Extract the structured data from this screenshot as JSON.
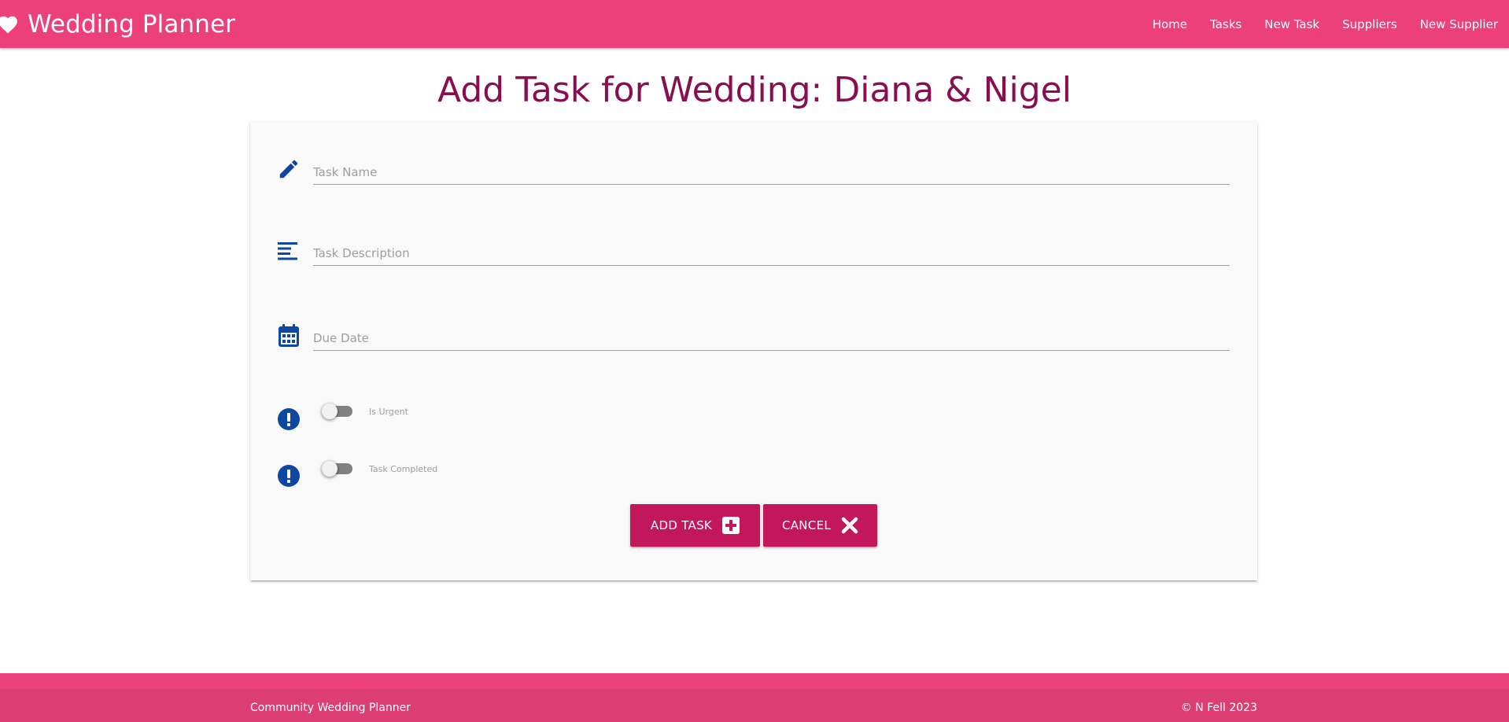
{
  "navbar": {
    "brand_icon": "heart-icon",
    "brand": "Wedding Planner",
    "links": [
      "Home",
      "Tasks",
      "New Task",
      "Suppliers",
      "New Supplier"
    ]
  },
  "page": {
    "title": "Add Task for Wedding: Diana & Nigel"
  },
  "form": {
    "task_name": {
      "icon": "pencil-icon",
      "placeholder": "Task Name",
      "value": ""
    },
    "task_description": {
      "icon": "text-lines-icon",
      "placeholder": "Task Description",
      "value": ""
    },
    "due_date": {
      "icon": "calendar-icon",
      "placeholder": "Due Date",
      "value": ""
    },
    "is_urgent": {
      "icon": "exclamation-circle-icon",
      "label": "Is Urgent",
      "checked": false
    },
    "task_completed": {
      "icon": "exclamation-circle-icon",
      "label": "Task Completed",
      "checked": false
    },
    "add_button": {
      "label": "ADD TASK",
      "icon": "plus-square-icon"
    },
    "cancel_button": {
      "label": "CANCEL",
      "icon": "close-icon"
    }
  },
  "footer": {
    "left": "Community Wedding Planner",
    "right": "© N Fell 2023"
  },
  "colors": {
    "navbar": "#ec407a",
    "title": "#880e4f",
    "icon": "#0d47a1",
    "button": "#c2185b",
    "footer_copyright": "#dc3e73"
  }
}
